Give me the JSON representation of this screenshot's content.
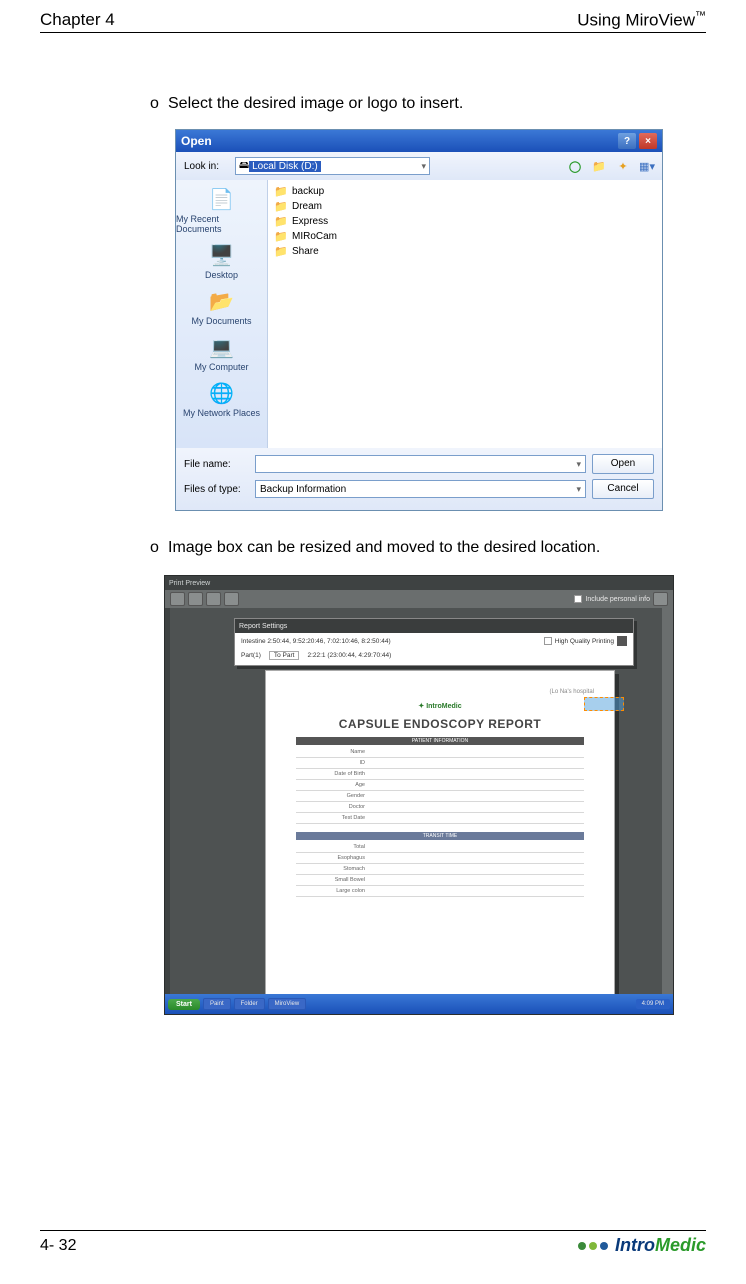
{
  "header": {
    "chapter": "Chapter 4",
    "title": "Using MiroView",
    "tm": "™"
  },
  "bullets": {
    "b1": "Select the desired image or logo to insert.",
    "b2": "Image box can be resized and moved to the desired location.",
    "marker": "o"
  },
  "open_dialog": {
    "title": "Open",
    "lookin_label": "Look in:",
    "lookin_value": "Local Disk (D:)",
    "folders": [
      "backup",
      "Dream",
      "Express",
      "MIRoCam",
      "Share"
    ],
    "filename_label": "File name:",
    "filename_value": "",
    "filetype_label": "Files of type:",
    "filetype_value": "Backup Information",
    "open_btn": "Open",
    "cancel_btn": "Cancel",
    "places": {
      "recent": "My Recent Documents",
      "desktop": "Desktop",
      "mydocs": "My Documents",
      "mycomp": "My Computer",
      "network": "My Network Places"
    }
  },
  "preview": {
    "window_title": "Print Preview",
    "include_personal": "Include personal info",
    "report_settings_title": "Report Settings",
    "rs_line1": "Intestine 2:50:44, 9:52:20:46, 7:02:10:46, 8:2:50:44)",
    "rs_line2_label": "Part(1)",
    "rs_line2_pages": "To Part",
    "rs_line2_rest": "2:22:1 (23:00:44, 4:29:70:44)",
    "high_quality": "High Quality Printing",
    "hospital_label": "(Lo Na's hospital",
    "logo": "IntroMedic",
    "report_title": "CAPSULE ENDOSCOPY REPORT",
    "section1": "PATIENT INFORMATION",
    "section2": "TRANSIT TIME",
    "fields1": [
      "Name",
      "ID",
      "Date of Birth",
      "Age",
      "Gender",
      "Doctor",
      "Test Date"
    ],
    "fields2": [
      "Total",
      "Esophagus",
      "Stomach",
      "Small Bowel",
      "Large colon"
    ],
    "taskbar": {
      "start": "Start",
      "items": [
        "Paint",
        "Folder",
        "MiroView"
      ],
      "tray": "4:09 PM"
    }
  },
  "footer": {
    "page": "4- 32",
    "logo_intro": "Intro",
    "logo_medic": "Medic"
  }
}
